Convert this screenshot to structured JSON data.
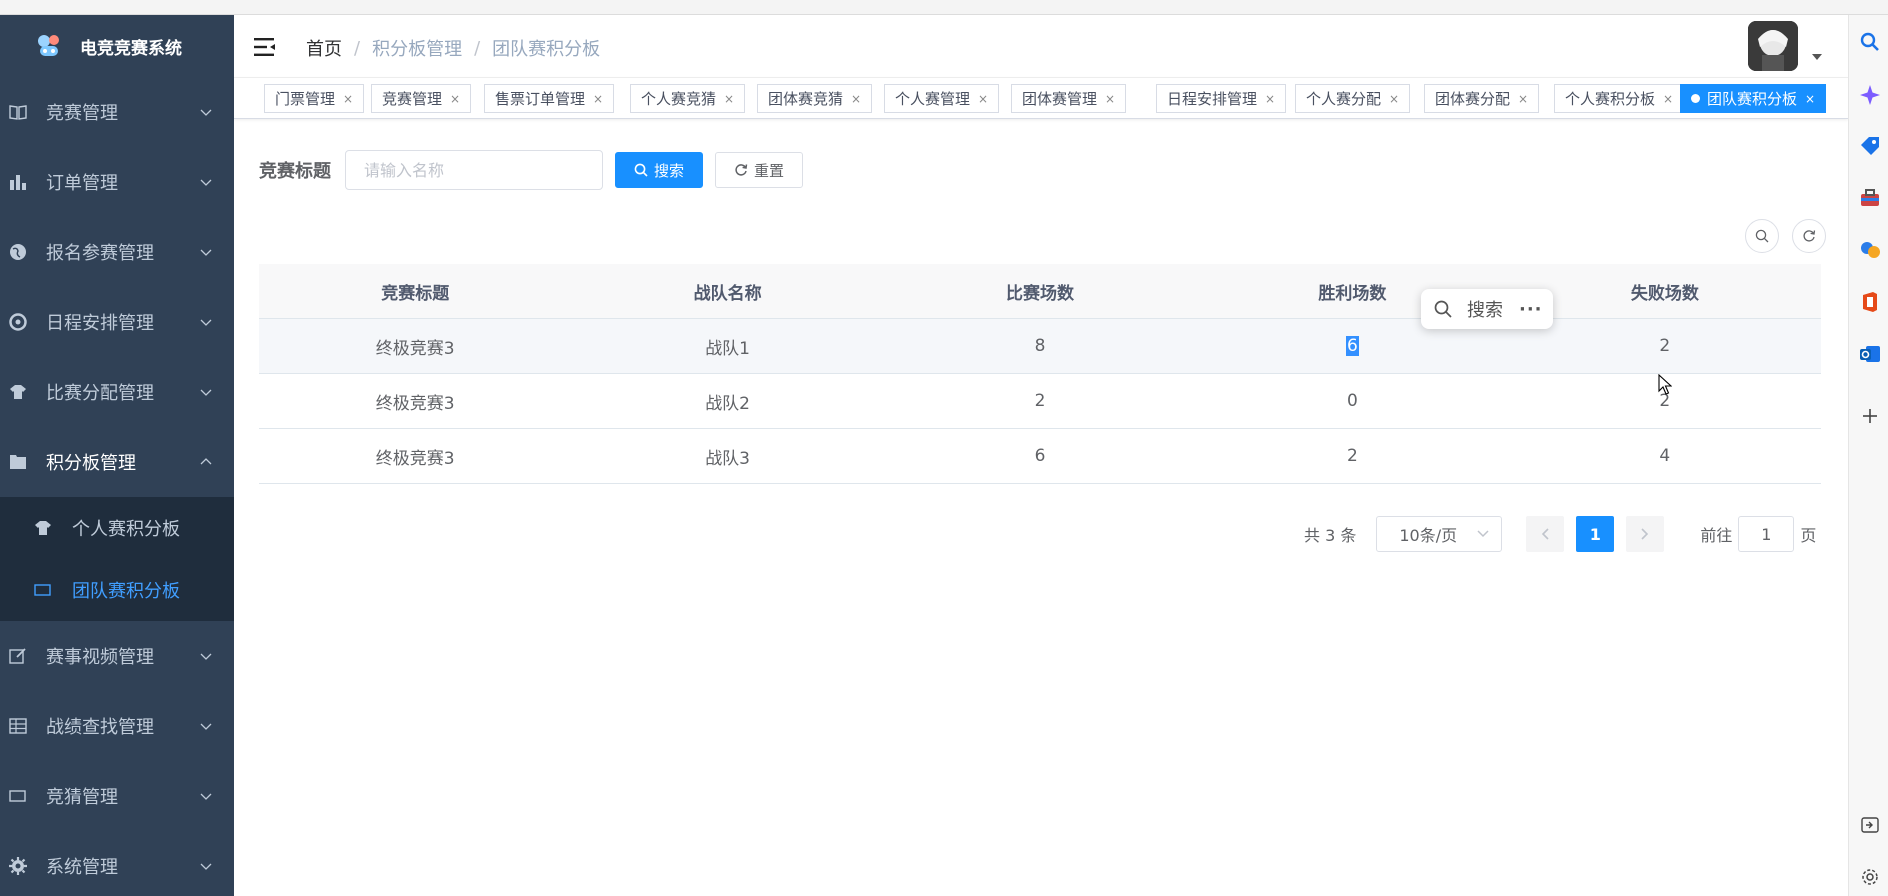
{
  "app": {
    "title": "电竞竞赛系统"
  },
  "sidebar": {
    "items": [
      {
        "label": "竞赛管理",
        "icon": "book-icon"
      },
      {
        "label": "订单管理",
        "icon": "chart-icon"
      },
      {
        "label": "报名参赛管理",
        "icon": "globe-icon"
      },
      {
        "label": "日程安排管理",
        "icon": "dashboard-icon"
      },
      {
        "label": "比赛分配管理",
        "icon": "shirt-icon"
      },
      {
        "label": "积分板管理",
        "icon": "folder-icon",
        "open": true
      },
      {
        "label": "赛事视频管理",
        "icon": "edit-icon"
      },
      {
        "label": "战绩查找管理",
        "icon": "table-icon"
      },
      {
        "label": "竞猜管理",
        "icon": "monitor-icon"
      },
      {
        "label": "系统管理",
        "icon": "gear-icon"
      }
    ],
    "submenu": [
      {
        "label": "个人赛积分板",
        "icon": "shirt-icon"
      },
      {
        "label": "团队赛积分板",
        "icon": "monitor-icon",
        "active": true
      }
    ]
  },
  "breadcrumb": {
    "home": "首页",
    "level1": "积分板管理",
    "level2": "团队赛积分板",
    "sep": "/"
  },
  "tags": [
    {
      "label": "门票管理"
    },
    {
      "label": "竞赛管理"
    },
    {
      "label": "售票订单管理"
    },
    {
      "label": "个人赛竞猜"
    },
    {
      "label": "团体赛竞猜"
    },
    {
      "label": "个人赛管理"
    },
    {
      "label": "团体赛管理"
    },
    {
      "label": "日程安排管理"
    },
    {
      "label": "个人赛分配"
    },
    {
      "label": "团体赛分配"
    },
    {
      "label": "个人赛积分板"
    },
    {
      "label": "团队赛积分板",
      "active": true
    }
  ],
  "tag_close": "×",
  "search": {
    "label": "竞赛标题",
    "placeholder": "请输入名称",
    "value": "",
    "search_button": "搜索",
    "reset_button": "重置"
  },
  "table": {
    "columns": [
      "竞赛标题",
      "战队名称",
      "比赛场数",
      "胜利场数",
      "失败场数"
    ],
    "rows": [
      [
        "终极竞赛3",
        "战队1",
        "8",
        "6",
        "2"
      ],
      [
        "终极竞赛3",
        "战队2",
        "2",
        "0",
        "2"
      ],
      [
        "终极竞赛3",
        "战队3",
        "6",
        "2",
        "4"
      ]
    ]
  },
  "popup": {
    "label": "搜索",
    "more": "···"
  },
  "pagination": {
    "total": "共 3 条",
    "page_size": "10条/页",
    "current": "1",
    "goto_prefix": "前往",
    "goto_value": "1",
    "goto_suffix": "页"
  },
  "colors": {
    "sidebar_bg": "#304156",
    "accent": "#1890ff",
    "active_menu": "#409eff"
  }
}
